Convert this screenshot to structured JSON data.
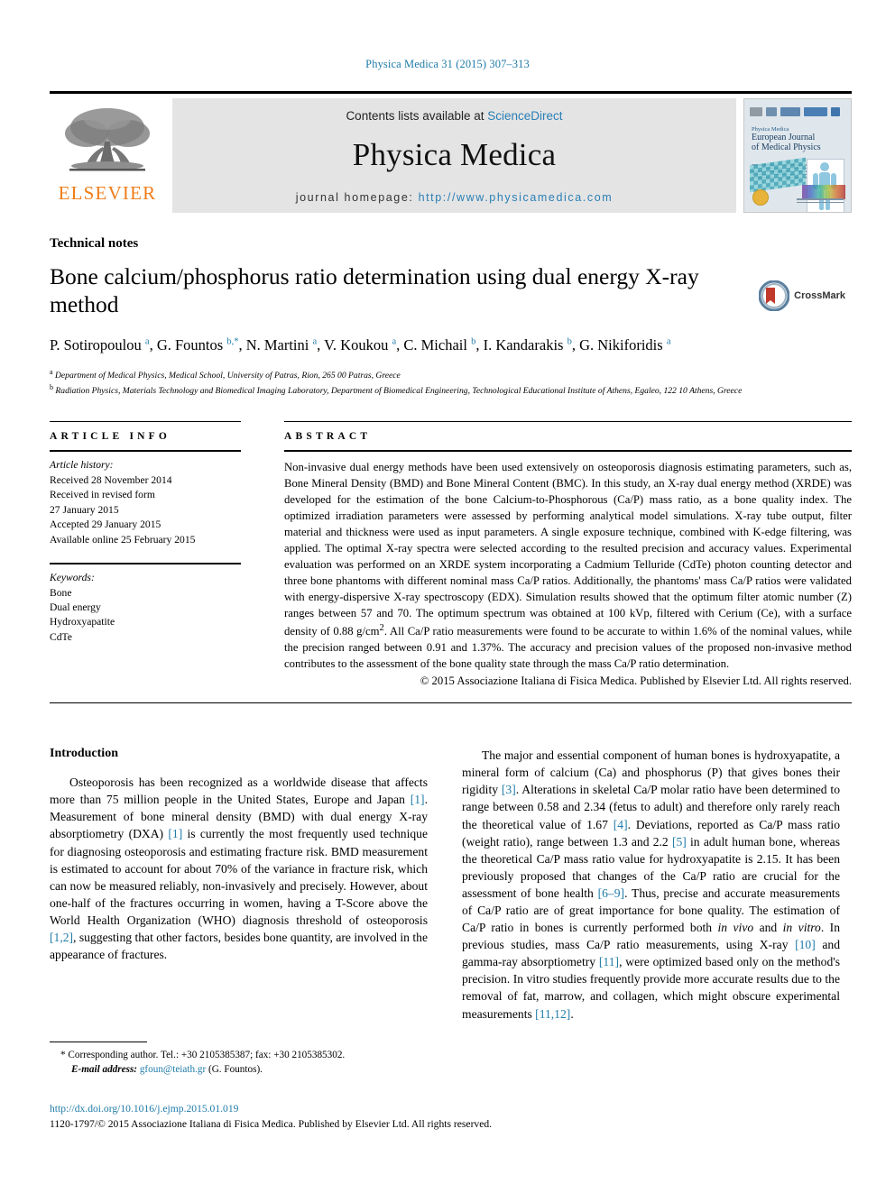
{
  "running_head": "Physica Medica 31 (2015) 307–313",
  "masthead": {
    "publisher_name": "ELSEVIER",
    "contents_prefix": "Contents lists available at ",
    "contents_link": "ScienceDirect",
    "journal_title": "Physica Medica",
    "homepage_prefix": "journal homepage: ",
    "homepage_url": "http://www.physicamedica.com",
    "cover": {
      "kicker": "Physica Medica",
      "title_line1": "European Journal",
      "title_line2": "of Medical Physics"
    }
  },
  "article": {
    "kicker": "Technical notes",
    "title": "Bone calcium/phosphorus ratio determination using dual energy X-ray method",
    "crossmark_label": "CrossMark",
    "authors_html": "P. Sotiropoulou <sup>a</sup>, G. Fountos <sup>b,&#42;</sup>, N. Martini <sup>a</sup>, V. Koukou <sup>a</sup>, C. Michail <sup>b</sup>, I. Kandarakis <sup>b</sup>, G. Nikiforidis <sup>a</sup>",
    "affiliation_a": "Department of Medical Physics, Medical School, University of Patras, Rion, 265 00 Patras, Greece",
    "affiliation_b": "Radiation Physics, Materials Technology and Biomedical Imaging Laboratory, Department of Biomedical Engineering, Technological Educational Institute of Athens, Egaleo, 122 10 Athens, Greece"
  },
  "article_info": {
    "heading": "ARTICLE INFO",
    "history_label": "Article history:",
    "history": [
      "Received 28 November 2014",
      "Received in revised form",
      "27 January 2015",
      "Accepted 29 January 2015",
      "Available online 25 February 2015"
    ],
    "keywords_label": "Keywords:",
    "keywords": [
      "Bone",
      "Dual energy",
      "Hydroxyapatite",
      "CdTe"
    ]
  },
  "abstract": {
    "heading": "ABSTRACT",
    "text": "Non-invasive dual energy methods have been used extensively on osteoporosis diagnosis estimating parameters, such as, Bone Mineral Density (BMD) and Bone Mineral Content (BMC). In this study, an X-ray dual energy method (XRDE) was developed for the estimation of the bone Calcium-to-Phosphorous (Ca/P) mass ratio, as a bone quality index. The optimized irradiation parameters were assessed by performing analytical model simulations. X-ray tube output, filter material and thickness were used as input parameters. A single exposure technique, combined with K-edge filtering, was applied. The optimal X-ray spectra were selected according to the resulted precision and accuracy values. Experimental evaluation was performed on an XRDE system incorporating a Cadmium Telluride (CdTe) photon counting detector and three bone phantoms with different nominal mass Ca/P ratios. Additionally, the phantoms' mass Ca/P ratios were validated with energy-dispersive X-ray spectroscopy (EDX). Simulation results showed that the optimum filter atomic number (Z) ranges between 57 and 70. The optimum spectrum was obtained at 100 kVp, filtered with Cerium (Ce), with a surface density of 0.88 g/cm",
    "text_sup": "2",
    "text_tail": ". All Ca/P ratio measurements were found to be accurate to within 1.6% of the nominal values, while the precision ranged between 0.91 and 1.37%. The accuracy and precision values of the proposed non-invasive method contributes to the assessment of the bone quality state through the mass Ca/P ratio determination.",
    "copyright": "© 2015 Associazione Italiana di Fisica Medica. Published by Elsevier Ltd. All rights reserved."
  },
  "body": {
    "intro_heading": "Introduction",
    "left_paragraph_parts": {
      "p1": "Osteoporosis has been recognized as a worldwide disease that affects more than 75 million people in the United States, Europe and Japan ",
      "r1": "[1]",
      "p2": ". Measurement of bone mineral density (BMD) with dual energy X-ray absorptiometry (DXA) ",
      "r2": "[1]",
      "p3": " is currently the most frequently used technique for diagnosing osteoporosis and estimating fracture risk. BMD measurement is estimated to account for about 70% of the variance in fracture risk, which can now be measured reliably, non-invasively and precisely. However, about one-half of the fractures occurring in women, having a T-Score above the World Health Organization (WHO) diagnosis threshold of osteoporosis ",
      "r3": "[1,2]",
      "p4": ", suggesting that other factors, besides bone quantity, are involved in the appearance of fractures."
    },
    "right_paragraph_parts": {
      "p1": "The major and essential component of human bones is hydroxyapatite, a mineral form of calcium (Ca) and phosphorus (P) that gives bones their rigidity ",
      "r1": "[3]",
      "p2": ". Alterations in skeletal Ca/P molar ratio have been determined to range between 0.58 and 2.34 (fetus to adult) and therefore only rarely reach the theoretical value of 1.67 ",
      "r2": "[4]",
      "p3": ". Deviations, reported as Ca/P mass ratio (weight ratio), range between 1.3 and 2.2 ",
      "r3": "[5]",
      "p4": " in adult human bone, whereas the theoretical Ca/P mass ratio value for hydroxyapatite is 2.15. It has been previously proposed that changes of the Ca/P ratio are crucial for the assessment of bone health ",
      "r4": "[6–9]",
      "p5": ". Thus, precise and accurate measurements of Ca/P ratio are of great importance for bone quality. The estimation of Ca/P ratio in bones is currently performed both ",
      "i1": "in vivo",
      "p6": " and ",
      "i2": "in vitro",
      "p7": ". In previous studies, mass Ca/P ratio measurements, using X-ray ",
      "r5": "[10]",
      "p8": " and gamma-ray absorptiometry ",
      "r6": "[11]",
      "p9": ", were optimized based only on the method's precision. In vitro studies frequently provide more accurate results due to the removal of fat, marrow, and collagen, which might obscure experimental measurements ",
      "r7": "[11,12]",
      "p10": "."
    }
  },
  "footnote": {
    "marker": "*",
    "text_before_mail": "Corresponding author. Tel.: +30 2105385387; fax: +30 2105385302.",
    "email_label": "E-mail address:",
    "email": "gfoun@teiath.gr",
    "email_suffix": "(G. Fountos)."
  },
  "footer": {
    "doi": "http://dx.doi.org/10.1016/j.ejmp.2015.01.019",
    "issn_line": "1120-1797/© 2015 Associazione Italiana di Fisica Medica. Published by Elsevier Ltd. All rights reserved."
  },
  "colors": {
    "link_blue": "#1f7ba8",
    "elsevier_orange": "#ef7d1a",
    "band_gray": "#e4e4e4"
  }
}
